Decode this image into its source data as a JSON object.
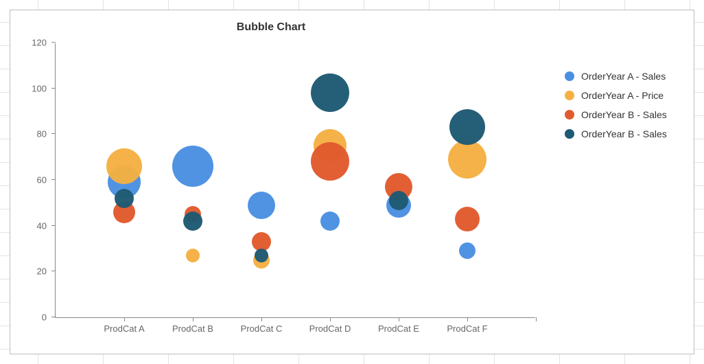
{
  "chart_data": {
    "type": "bubble",
    "title": "Bubble Chart",
    "ylim": [
      0,
      120
    ],
    "y_ticks": [
      0,
      20,
      40,
      60,
      80,
      100,
      120
    ],
    "categories": [
      "ProdCat A",
      "ProdCat B",
      "ProdCat C",
      "ProdCat D",
      "ProdCat E",
      "ProdCat F"
    ],
    "series": [
      {
        "name": "OrderYear A - Sales",
        "color": "#4a90e2",
        "points": [
          {
            "x": 0,
            "y": 59,
            "r": 24
          },
          {
            "x": 1,
            "y": 66,
            "r": 30
          },
          {
            "x": 2,
            "y": 49,
            "r": 20
          },
          {
            "x": 3,
            "y": 42,
            "r": 14
          },
          {
            "x": 4,
            "y": 49,
            "r": 18
          },
          {
            "x": 5,
            "y": 29,
            "r": 12
          }
        ]
      },
      {
        "name": "OrderYear A - Price",
        "color": "#f5b042",
        "points": [
          {
            "x": 0,
            "y": 66,
            "r": 26
          },
          {
            "x": 1,
            "y": 27,
            "r": 10
          },
          {
            "x": 2,
            "y": 25,
            "r": 12
          },
          {
            "x": 3,
            "y": 75,
            "r": 24
          },
          {
            "x": 5,
            "y": 69,
            "r": 28
          }
        ]
      },
      {
        "name": "OrderYear B - Sales",
        "color": "#e15a2d",
        "points": [
          {
            "x": 0,
            "y": 46,
            "r": 16
          },
          {
            "x": 1,
            "y": 45,
            "r": 12
          },
          {
            "x": 2,
            "y": 33,
            "r": 14
          },
          {
            "x": 3,
            "y": 68,
            "r": 28
          },
          {
            "x": 4,
            "y": 57,
            "r": 20
          },
          {
            "x": 5,
            "y": 43,
            "r": 18
          }
        ]
      },
      {
        "name": "OrderYear B - Sales",
        "color": "#1e5a73",
        "points": [
          {
            "x": 0,
            "y": 52,
            "r": 14
          },
          {
            "x": 1,
            "y": 42,
            "r": 14
          },
          {
            "x": 2,
            "y": 27,
            "r": 10
          },
          {
            "x": 3,
            "y": 98,
            "r": 28
          },
          {
            "x": 4,
            "y": 51,
            "r": 14
          },
          {
            "x": 5,
            "y": 83,
            "r": 26
          }
        ]
      }
    ],
    "xlabel": "",
    "ylabel": ""
  }
}
